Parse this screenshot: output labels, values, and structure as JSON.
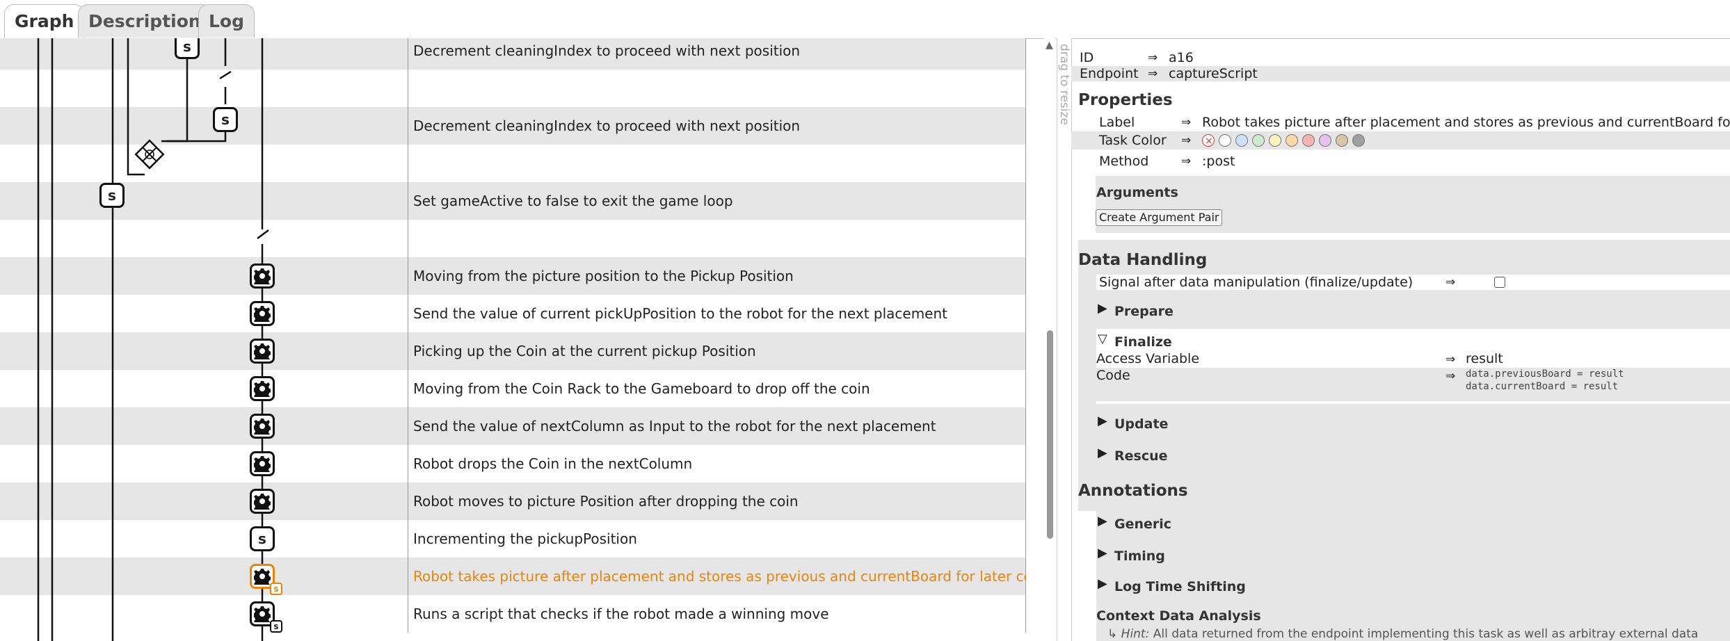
{
  "tabs": [
    "Graph",
    "Description",
    "Log"
  ],
  "graph": {
    "rows": [
      {
        "label": "Decrement cleaningIndex to proceed with next position",
        "id": "a2"
      },
      {
        "label": "",
        "id": ""
      },
      {
        "label": "Decrement cleaningIndex to proceed with next position",
        "id": "a2"
      },
      {
        "label": "",
        "id": ""
      },
      {
        "label": "Set gameActive to false to exit the game loop",
        "id": "a1"
      },
      {
        "label": "",
        "id": ""
      },
      {
        "label": "Moving from the picture position to the Pickup Position",
        "id": "a1"
      },
      {
        "label": "Send the value of current pickUpPosition to the robot for the next placement",
        "id": "a2"
      },
      {
        "label": "Picking up the Coin at the current pickup Position",
        "id": "a3"
      },
      {
        "label": "Moving from the Coin Rack to the Gameboard to drop off the coin",
        "id": "a6"
      },
      {
        "label": "Send the value of nextColumn as Input to the robot for the next placement",
        "id": "a1"
      },
      {
        "label": "Robot drops the Coin in the nextColumn",
        "id": "a7"
      },
      {
        "label": "Robot moves to picture Position after dropping the coin",
        "id": "a1"
      },
      {
        "label": "Incrementing the pickupPosition",
        "id": "a2"
      },
      {
        "label": "Robot takes picture after placement and stores as previous and currentBoard for later comparison",
        "id": "a1"
      },
      {
        "label": "Runs a script that checks if the robot made a winning move",
        "id": "a5"
      }
    ],
    "node_letter": "s"
  },
  "drag_label": "drag to resize",
  "panel": {
    "id_label": "ID",
    "id_value": "a16",
    "endpoint_label": "Endpoint",
    "endpoint_value": "captureScript",
    "arrow": "⇒",
    "properties_title": "Properties",
    "label_label": "Label",
    "label_value": "Robot takes picture after placement and stores as previous and currentBoard for later comparison",
    "color_label": "Task Color",
    "colors": [
      "#ffffff",
      "#ffffff",
      "#cfe0ff",
      "#cdeccd",
      "#fff6bf",
      "#ffd9a8",
      "#f7b3b3",
      "#e6c3ee",
      "#d9c6a8",
      "#a0a0a0"
    ],
    "method_label": "Method",
    "method_value": ":post",
    "arguments_title": "Arguments",
    "create_argument_button": "Create Argument Pair",
    "data_handling_title": "Data Handling",
    "signal_label": "Signal after data manipulation (finalize/update)",
    "sections": {
      "prepare": "Prepare",
      "finalize": "Finalize",
      "update": "Update",
      "rescue": "Rescue"
    },
    "access_variable_label": "Access Variable",
    "access_variable_value": "result",
    "code_label": "Code",
    "code_lines": [
      "data.previousBoard = result",
      "data.currentBoard = result"
    ],
    "annotations_title": "Annotations",
    "annotation_sections": {
      "generic": "Generic",
      "timing": "Timing",
      "log_time_shifting": "Log Time Shifting"
    },
    "context_title": "Context Data Analysis",
    "hint_prefix": "↳",
    "hint_label": "Hint:",
    "hint_text": "All data returned from the endpoint implementing this task as well as arbitray external data"
  }
}
